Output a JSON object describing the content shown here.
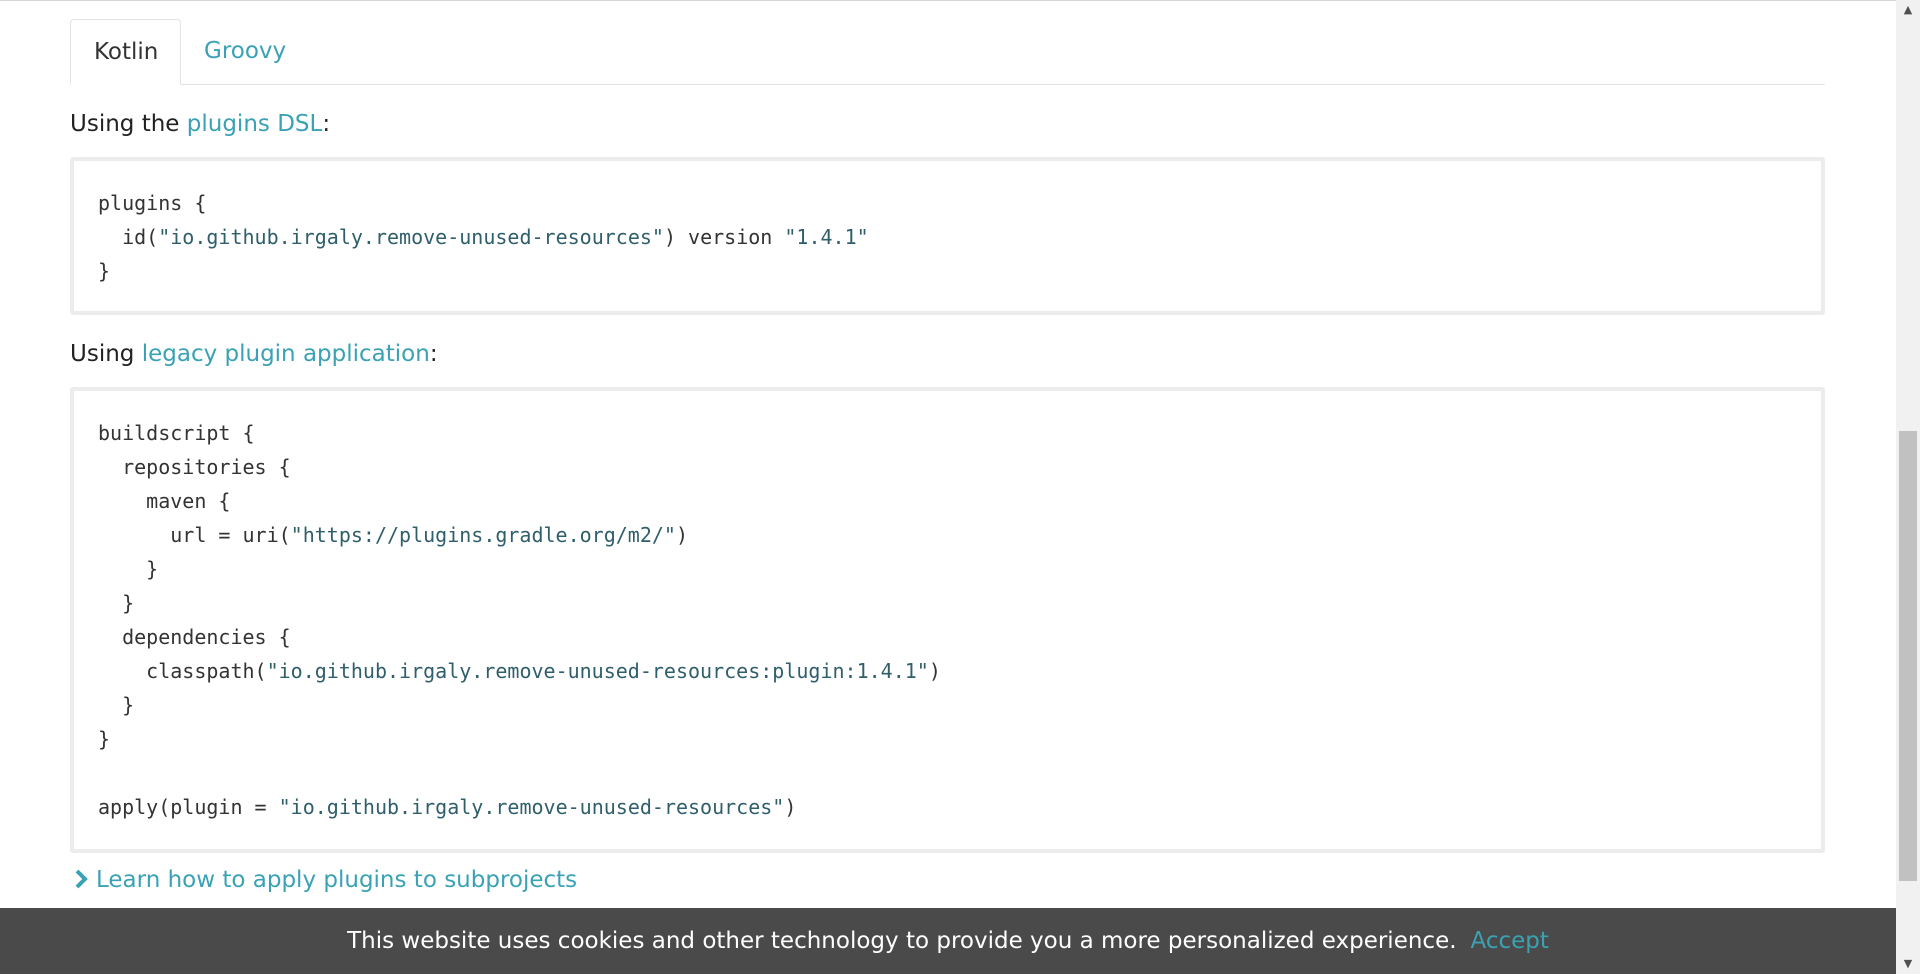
{
  "tabs": [
    {
      "label": "Kotlin",
      "active": true
    },
    {
      "label": "Groovy",
      "active": false
    }
  ],
  "section_dsl": {
    "prefix": "Using the ",
    "link": "plugins DSL",
    "suffix": ":"
  },
  "code_dsl": {
    "lines": [
      [
        "plugins {",
        ""
      ],
      [
        "  id(",
        "\"io.github.irgaly.remove-unused-resources\"",
        ") version ",
        "\"1.4.1\""
      ],
      [
        "}"
      ]
    ]
  },
  "section_legacy": {
    "prefix": "Using ",
    "link": "legacy plugin application",
    "suffix": ":"
  },
  "code_legacy": {
    "l1": "buildscript {",
    "l2": "  repositories {",
    "l3": "    maven {",
    "l4a": "      url = uri(",
    "l4b": "\"https://plugins.gradle.org/m2/\"",
    "l4c": ")",
    "l5": "    }",
    "l6": "  }",
    "l7": "  dependencies {",
    "l8a": "    classpath(",
    "l8b": "\"io.github.irgaly.remove-unused-resources:plugin:1.4.1\"",
    "l8c": ")",
    "l9": "  }",
    "l10": "}",
    "l12a": "apply(plugin = ",
    "l12b": "\"io.github.irgaly.remove-unused-resources\"",
    "l12c": ")"
  },
  "code_dsl_text": {
    "l1": "plugins {",
    "l2a": "  id(",
    "l2b": "\"io.github.irgaly.remove-unused-resources\"",
    "l2c": ") version ",
    "l2d": "\"1.4.1\"",
    "l3": "}"
  },
  "learn_link": "Learn how to apply plugins to subprojects",
  "cookie": {
    "message": "This website uses cookies and other technology to provide you a more personalized experience.",
    "accept_label": "Accept"
  },
  "colors": {
    "link": "#3aa2b4",
    "banner_bg": "#4a4a4a"
  }
}
